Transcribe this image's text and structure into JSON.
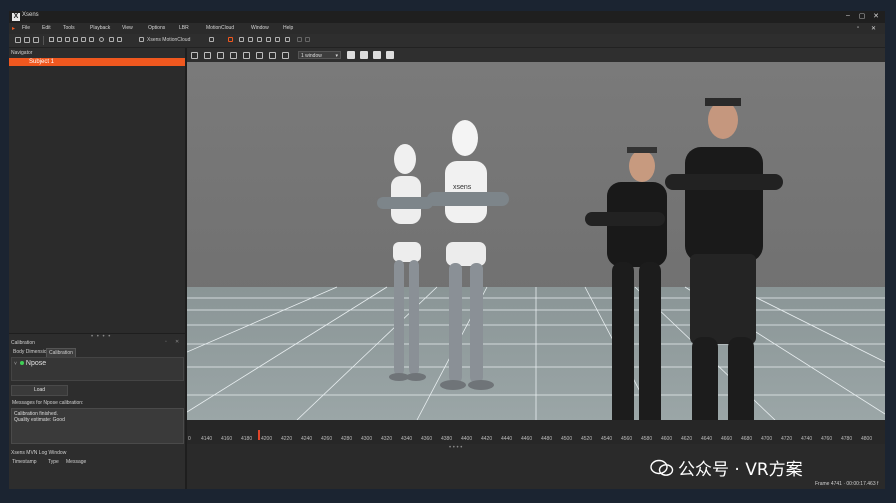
{
  "window": {
    "title": "Xsens",
    "logo_glyph": "X",
    "controls": [
      "–",
      "▢",
      "✕"
    ]
  },
  "menu": [
    "File",
    "Edit",
    "Tools",
    "Playback",
    "View",
    "Options",
    "LBR",
    "MotionCloud",
    "Window",
    "Help"
  ],
  "toolbar": {
    "motioncloud_label": "Xsens MotionCloud"
  },
  "navigator": {
    "title": "Navigator",
    "subject": "Subject 1"
  },
  "calibration": {
    "title": "Calibration",
    "tabs": [
      "Body Dimensions",
      "Calibration"
    ],
    "active_tab": "Calibration",
    "npose_label": "Npose",
    "load_label": "Load",
    "messages_label": "Messages for Npose calibration:",
    "messages": [
      "Calibration finished.",
      "Quality estimate: Good"
    ]
  },
  "log": {
    "title": "Xsens MVN Log Window",
    "columns": [
      "Timestamp",
      "Type",
      "Message"
    ]
  },
  "viewport": {
    "layout_select": "1 window"
  },
  "timeline": {
    "ticks": [
      "0",
      "4140",
      "4160",
      "4180",
      "4200",
      "4220",
      "4240",
      "4260",
      "4280",
      "4300",
      "4320",
      "4340",
      "4360",
      "4380",
      "4400",
      "4420",
      "4440",
      "4460",
      "4480",
      "4500",
      "4520",
      "4540",
      "4560",
      "4580",
      "4600",
      "4620",
      "4640",
      "4660",
      "4680",
      "4700",
      "4720",
      "4740",
      "4760",
      "4780",
      "4800"
    ]
  },
  "status": {
    "frame_info": "Frame 4741 · 00:00:17.463 f"
  },
  "watermark": {
    "text": "公众号 · VR方案"
  },
  "colors": {
    "accent": "#f0581f",
    "status_green": "#3fcf55"
  },
  "icons": {
    "menu_toolbar": [
      "new-file-icon",
      "open-icon",
      "save-icon",
      "play-icon",
      "record-icon",
      "settings-icon"
    ]
  }
}
